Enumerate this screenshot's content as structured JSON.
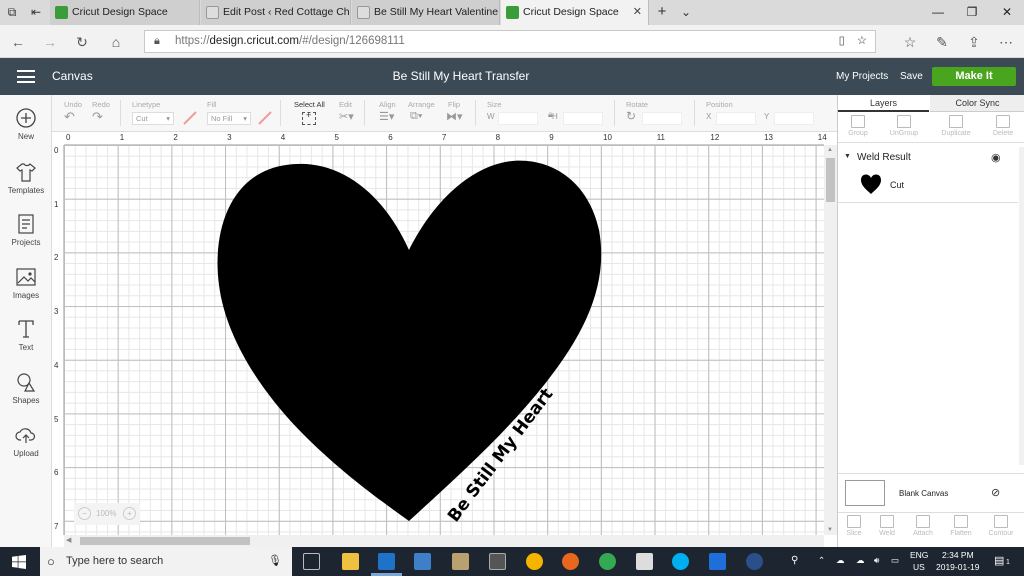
{
  "browser": {
    "tabs": [
      {
        "title": "Cricut Design Space",
        "active": false,
        "icon": "cricut-icon"
      },
      {
        "title": "Edit Post ‹ Red Cottage Chr",
        "active": false,
        "icon": "wordpress-icon"
      },
      {
        "title": "Be Still My Heart Valentine T",
        "active": false,
        "icon": "wordpress-icon"
      },
      {
        "title": "Cricut Design Space",
        "active": true,
        "icon": "cricut-icon"
      }
    ],
    "url_scheme": "https://",
    "url_host": "design.cricut.com",
    "url_path": "/#/design/126698111"
  },
  "app": {
    "menu_label": "Canvas",
    "project_title": "Be Still My Heart Transfer",
    "my_projects": "My Projects",
    "save": "Save",
    "make_it": "Make It",
    "accent_color": "#4aa51e",
    "header_color": "#3b4a55"
  },
  "sidebar": {
    "items": [
      {
        "label": "New",
        "icon": "plus-circle-icon"
      },
      {
        "label": "Templates",
        "icon": "shirt-icon"
      },
      {
        "label": "Projects",
        "icon": "projects-icon"
      },
      {
        "label": "Images",
        "icon": "image-icon"
      },
      {
        "label": "Text",
        "icon": "text-icon"
      },
      {
        "label": "Shapes",
        "icon": "shapes-icon"
      },
      {
        "label": "Upload",
        "icon": "cloud-upload-icon"
      }
    ]
  },
  "toolbar": {
    "undo": "Undo",
    "redo": "Redo",
    "linetype": "Linetype",
    "linetype_value": "Cut",
    "fill": "Fill",
    "fill_value": "No Fill",
    "select_all": "Select All",
    "edit": "Edit",
    "align": "Align",
    "arrange": "Arrange",
    "flip": "Flip",
    "size": "Size",
    "size_w": "W",
    "size_h": "H",
    "rotate": "Rotate",
    "position": "Position",
    "pos_x": "X",
    "pos_y": "Y"
  },
  "canvas": {
    "ruler_top": [
      "0",
      "1",
      "2",
      "3",
      "4",
      "5",
      "6",
      "7",
      "8",
      "9",
      "10",
      "11",
      "12",
      "13",
      "14"
    ],
    "ruler_left": [
      "0",
      "1",
      "2",
      "3",
      "4",
      "5",
      "6",
      "7"
    ],
    "zoom": "100%",
    "design_text": "Be Still My Heart"
  },
  "panel": {
    "tab_layers": "Layers",
    "tab_color_sync": "Color Sync",
    "tools": [
      "Group",
      "UnGroup",
      "Duplicate",
      "Delete"
    ],
    "group_name": "Weld Result",
    "layer_name": "Cut",
    "blank_canvas": "Blank Canvas",
    "bottom_tools": [
      "Slice",
      "Weld",
      "Attach",
      "Flatten",
      "Contour"
    ]
  },
  "taskbar": {
    "search_placeholder": "Type here to search",
    "lang": "ENG",
    "region": "US",
    "time": "2:34 PM",
    "date": "2019-01-19",
    "notifications": "1"
  }
}
